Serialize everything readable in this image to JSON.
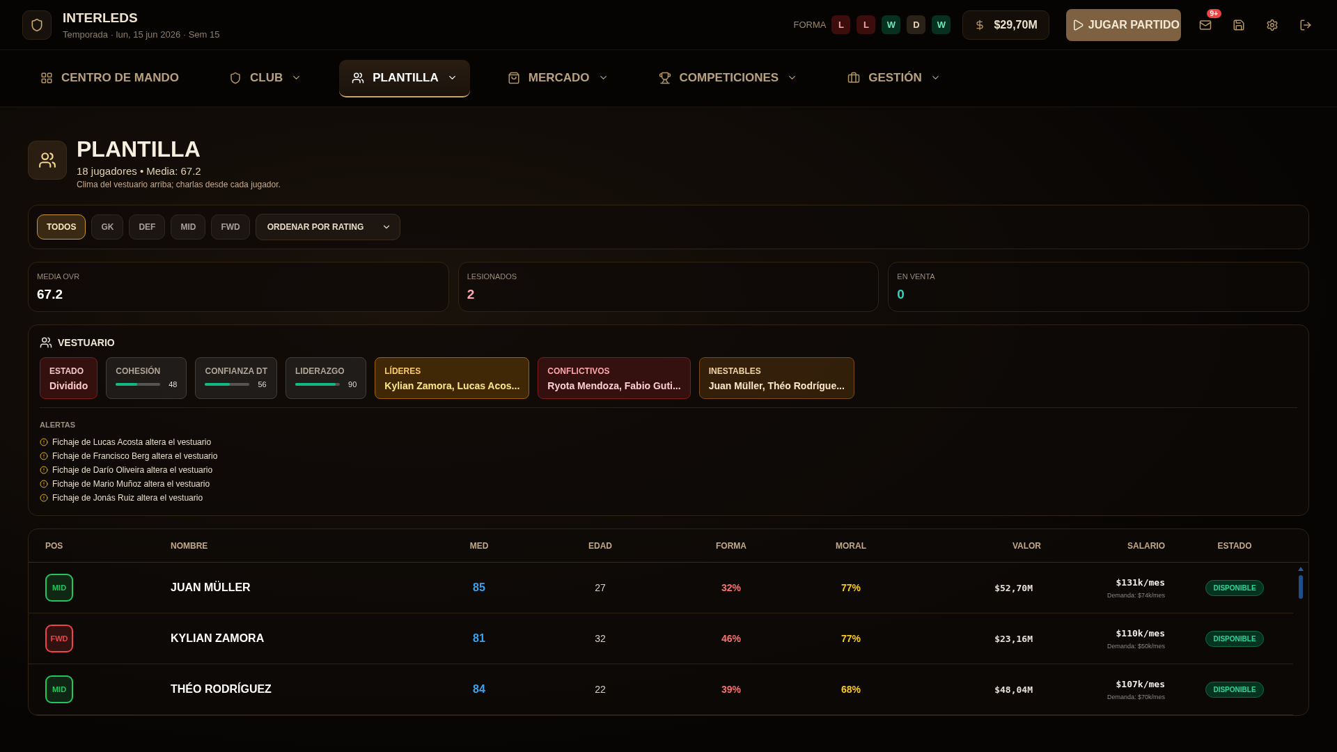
{
  "club": {
    "name": "INTERLEDS",
    "subtitle": "Temporada · lun, 15 jun 2026 · Sem 15"
  },
  "form": {
    "label": "FORMA",
    "results": [
      {
        "label": "L",
        "kind": "loss"
      },
      {
        "label": "L",
        "kind": "loss"
      },
      {
        "label": "W",
        "kind": "win"
      },
      {
        "label": "D",
        "kind": "draw"
      },
      {
        "label": "W",
        "kind": "win"
      }
    ]
  },
  "budget": "$29,70M",
  "play_button": "JUGAR PARTIDO",
  "mail_badge": "9+",
  "nav": [
    {
      "label": "CENTRO DE MANDO",
      "dropdown": false,
      "selected": false
    },
    {
      "label": "CLUB",
      "dropdown": true,
      "selected": false
    },
    {
      "label": "PLANTILLA",
      "dropdown": true,
      "selected": true
    },
    {
      "label": "MERCADO",
      "dropdown": true,
      "selected": false
    },
    {
      "label": "COMPETICIONES",
      "dropdown": true,
      "selected": false
    },
    {
      "label": "GESTIÓN",
      "dropdown": true,
      "selected": false
    }
  ],
  "page": {
    "title": "PLANTILLA",
    "summary": "18 jugadores • Media: 67.2",
    "note": "Clima del vestuario arriba; charlas desde cada jugador."
  },
  "filters": [
    {
      "label": "TODOS",
      "selected": true
    },
    {
      "label": "GK",
      "selected": false
    },
    {
      "label": "DEF",
      "selected": false
    },
    {
      "label": "MID",
      "selected": false
    },
    {
      "label": "FWD",
      "selected": false
    }
  ],
  "sort": "ORDENAR POR RATING",
  "stats": [
    {
      "label": "MEDIA OVR",
      "value": "67.2",
      "color": "#ffffff"
    },
    {
      "label": "LESIONADOS",
      "value": "2",
      "color": "#f9a8b4"
    },
    {
      "label": "EN VENTA",
      "value": "0",
      "color": "#2dd4bf"
    }
  ],
  "vestuario": {
    "title": "VESTUARIO",
    "cards": [
      {
        "kind": "status",
        "label": "ESTADO",
        "value": "Dividido",
        "color": "#7f1d1d"
      },
      {
        "kind": "meter",
        "label": "COHESIÓN",
        "level": 0.48,
        "reading": "48",
        "color": "#3f3f3f"
      },
      {
        "kind": "meter",
        "label": "CONFIANZA DT",
        "level": 0.56,
        "reading": "56",
        "color": "#3f3f3f"
      },
      {
        "kind": "meter",
        "label": "LIDERAZGO",
        "level": 0.9,
        "reading": "90",
        "color": "#3f3f3f"
      },
      {
        "kind": "list",
        "label": "LÍDERES",
        "value": "Kylian Zamora, Lucas Acos...",
        "color": "#a16207"
      },
      {
        "kind": "list",
        "label": "CONFLICTIVOS",
        "value": "Ryota Mendoza, Fabio Guti...",
        "color": "#7f1d1d"
      },
      {
        "kind": "list",
        "label": "INESTABLES",
        "value": "Juan Müller, Théo Rodrígue...",
        "color": "#7c4a12"
      }
    ],
    "alerts_title": "ALERTAS",
    "alerts": [
      "Fichaje de Lucas Acosta altera el vestuario",
      "Fichaje de Francisco Berg altera el vestuario",
      "Fichaje de Darío Oliveira altera el vestuario",
      "Fichaje de Mario Muñoz altera el vestuario",
      "Fichaje de Jonás Ruiz altera el vestuario"
    ]
  },
  "table": {
    "columns": [
      "POS",
      "NOMBRE",
      "MED",
      "EDAD",
      "FORMA",
      "MORAL",
      "VALOR",
      "SALARIO",
      "ESTADO"
    ],
    "rows": [
      {
        "pos": "MID",
        "color": "#22c55e",
        "name": "JUAN MÜLLER",
        "med": "85",
        "edad": "27",
        "forma": "32%",
        "moral": "77%",
        "valor": "$52,70M",
        "salario": "$131k/mes",
        "demanda": "Demanda: $74k/mes",
        "estado": "DISPONIBLE"
      },
      {
        "pos": "FWD",
        "color": "#ef4444",
        "name": "KYLIAN ZAMORA",
        "med": "81",
        "edad": "32",
        "forma": "46%",
        "moral": "77%",
        "valor": "$23,16M",
        "salario": "$110k/mes",
        "demanda": "Demanda: $50k/mes",
        "estado": "DISPONIBLE"
      },
      {
        "pos": "MID",
        "color": "#22c55e",
        "name": "THÉO RODRÍGUEZ",
        "med": "84",
        "edad": "22",
        "forma": "39%",
        "moral": "68%",
        "valor": "$48,04M",
        "salario": "$107k/mes",
        "demanda": "Demanda: $70k/mes",
        "estado": "DISPONIBLE"
      }
    ]
  }
}
